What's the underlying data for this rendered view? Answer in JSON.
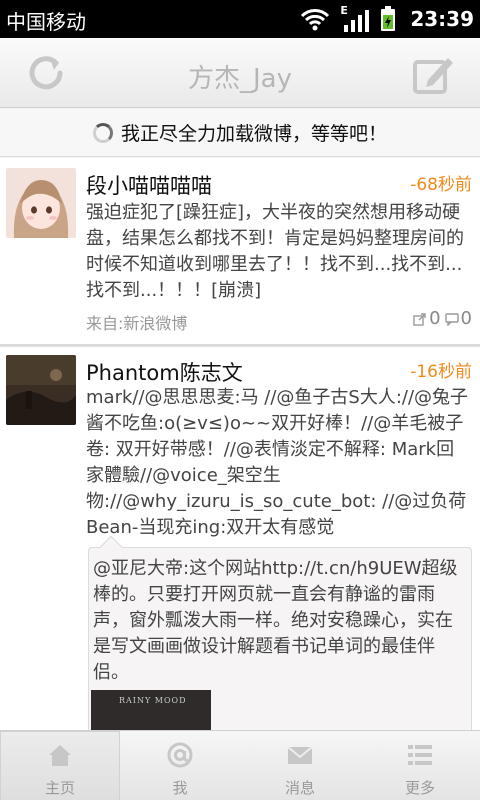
{
  "status_bar": {
    "carrier": "中国移动",
    "network": "E",
    "time": "23:39"
  },
  "title_bar": {
    "title": "方杰_Jay"
  },
  "loading": {
    "text": "我正尽全力加载微博，等等吧！"
  },
  "feed": [
    {
      "author": "段小喵喵喵喵",
      "time": "-68秒前",
      "content": "强迫症犯了[躁狂症]，大半夜的突然想用移动硬盘，结果怎么都找不到！肯定是妈妈整理房间的时候不知道收到哪里去了！！找不到...找不到...找不到...！！！[崩溃]",
      "source": "来自:新浪微博",
      "reposts": "0",
      "comments": "0"
    },
    {
      "author": "Phantom陈志文",
      "time": "-16秒前",
      "content": "mark//@思思思麦:马 //@鱼子古S大人://@兔子酱不吃鱼:o(≥v≤)o~~双开好棒！//@羊毛被子卷: 双开好带感！//@表情淡定不解释: Mark回家體驗//@voice_架空生物://@why_izuru_is_so_cute_bot: //@过负荷Bean-当现充ing:双开太有感觉",
      "repost": {
        "text": "@亚尼大帝:这个网站http://t.cn/h9UEW超级棒的。只要打开网页就一直会有静谧的雷雨声，窗外瓢泼大雨一样。绝对安稳躁心，实在是写文画画做设计解题看书记单词的最佳伴侣。",
        "image_label": "RAINY MOOD"
      }
    }
  ],
  "tabs": [
    {
      "label": "主页",
      "icon": "home-icon",
      "active": true
    },
    {
      "label": "我",
      "icon": "at-icon",
      "active": false
    },
    {
      "label": "消息",
      "icon": "mail-icon",
      "active": false
    },
    {
      "label": "更多",
      "icon": "more-icon",
      "active": false
    }
  ],
  "colors": {
    "time_accent": "#f08a1c",
    "title_text": "#b6b6b6",
    "status_bar": "#000000"
  }
}
